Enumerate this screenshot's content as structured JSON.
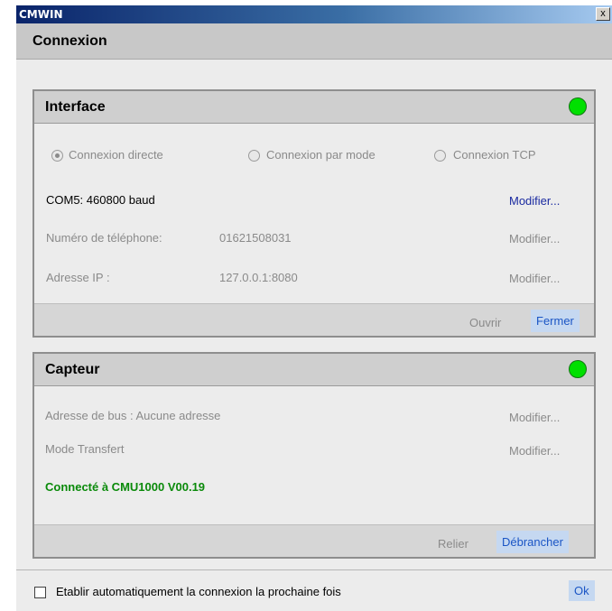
{
  "window": {
    "title": "CMWIN",
    "close_label": "x"
  },
  "header": {
    "title": "Connexion"
  },
  "interface": {
    "title": "Interface",
    "status_color": "#00e000",
    "radio_direct": "Connexion directe",
    "radio_modem": "Connexion par mode",
    "radio_tcp": "Connexion TCP",
    "com_value": "COM5: 460800 baud",
    "com_modify": "Modifier...",
    "phone_label": "Numéro de téléphone:",
    "phone_value": "01621508031",
    "phone_modify": "Modifier...",
    "ip_label": "Adresse IP :",
    "ip_value": "127.0.0.1:8080",
    "ip_modify": "Modifier...",
    "open_label": "Ouvrir",
    "close_label": "Fermer"
  },
  "sensor": {
    "title": "Capteur",
    "status_color": "#00e000",
    "bus_label": "Adresse de bus : Aucune adresse",
    "bus_modify": "Modifier...",
    "transfer_label": "Mode Transfert",
    "transfer_modify": "Modifier...",
    "connected_text": "Connecté à  CMU1000 V00.19",
    "link_label": "Relier",
    "disconnect_label": "Débrancher"
  },
  "footer": {
    "auto_connect_label": "Etablir automatiquement la connexion la prochaine fois",
    "ok_label": "Ok"
  }
}
